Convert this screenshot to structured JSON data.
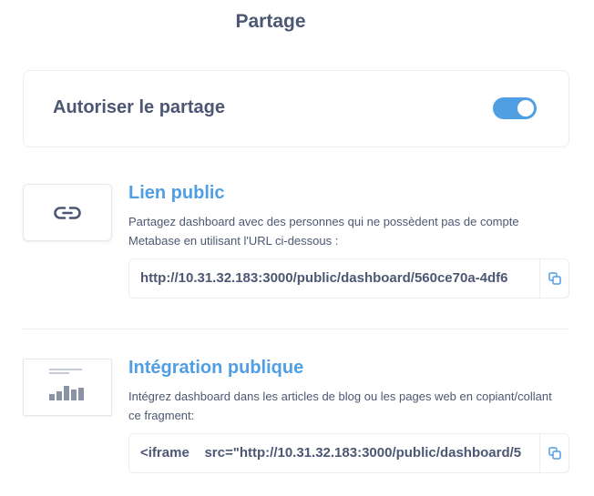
{
  "header": {
    "title": "Partage"
  },
  "sharing_toggle": {
    "label": "Autoriser le partage",
    "enabled": true,
    "accent": "#509ee3"
  },
  "public_link": {
    "title": "Lien public",
    "description": "Partagez dashboard avec des personnes qui ne possèdent pas de compte Metabase en utilisant l'URL ci-dessous :",
    "url": "http://10.31.32.183:3000/public/dashboard/560ce70a-4df6",
    "icon": "link-icon",
    "copy_icon": "copy-icon"
  },
  "public_embed": {
    "title": "Intégration publique",
    "description": "Intégrez dashboard dans les articles de blog ou les pages web en copiant/collant ce fragment:",
    "code": "<iframe    src=\"http://10.31.32.183:3000/public/dashboard/5",
    "icon": "embed-preview-icon",
    "copy_icon": "copy-icon"
  },
  "colors": {
    "brand": "#509ee3",
    "text": "#4c5773",
    "border": "#eeecec"
  }
}
